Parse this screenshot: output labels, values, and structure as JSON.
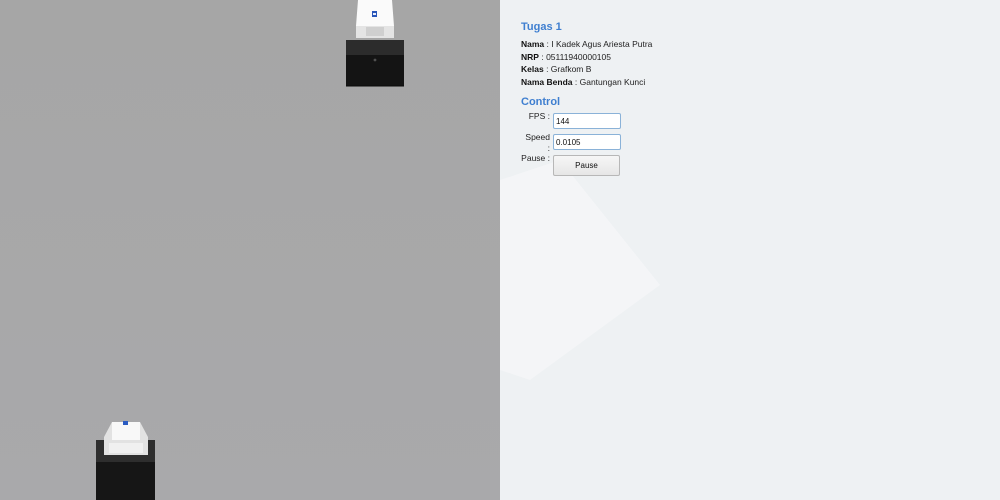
{
  "info": {
    "title": "Tugas 1",
    "rows": [
      {
        "key": "Nama",
        "value": "I Kadek Agus Ariesta Putra"
      },
      {
        "key": "NRP",
        "value": "05111940000105"
      },
      {
        "key": "Kelas",
        "value": "Grafkom B"
      },
      {
        "key": "Nama Benda",
        "value": "Gantungan Kunci"
      }
    ]
  },
  "control": {
    "title": "Control",
    "fps_label": "FPS :",
    "fps_value": "144",
    "speed_label": "Speed :",
    "speed_value": "0.0105",
    "pause_label": "Pause :",
    "pause_button": "Pause"
  },
  "scene": {
    "background": "#a7a7a8",
    "panel_background": "#eef1f3",
    "accent": "#3f7fd0",
    "objects": [
      {
        "name": "keychain-top"
      },
      {
        "name": "keychain-bottom"
      }
    ]
  }
}
